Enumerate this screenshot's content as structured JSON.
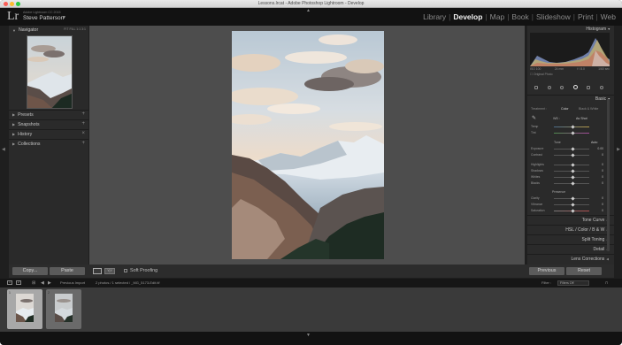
{
  "window": {
    "title": "Lessons.lrcat - Adobe Photoshop Lightroom - Develop"
  },
  "identity": {
    "logo": "Lr",
    "catalog_line": "Adobe Lightroom CC 2015",
    "user_name": "Steve Patterson"
  },
  "modules": [
    "Library",
    "Develop",
    "Map",
    "Book",
    "Slideshow",
    "Print",
    "Web"
  ],
  "active_module": "Develop",
  "left_panel": {
    "navigator": {
      "title": "Navigator",
      "zoom_options": "FIT  FILL  1:1  3:1"
    },
    "sections": [
      "Presets",
      "Snapshots",
      "History",
      "Collections"
    ],
    "copy_label": "Copy...",
    "paste_label": "Paste"
  },
  "toolbar": {
    "soft_proofing": "Soft Proofing",
    "compare_icon_label": "Y|Y"
  },
  "right_panel": {
    "histogram_title": "Histogram",
    "hist_info": [
      "ISO 100",
      "24 mm",
      "f / 8.0",
      "1/60 sec"
    ],
    "original_photo": "Original Photo",
    "basic_title": "Basic",
    "treatment_label": "Treatment :",
    "color_label": "Color",
    "bw_label": "Black & White",
    "wb_label": "WB :",
    "wb_value": "As Shot",
    "temp_label": "Temp",
    "tint_label": "Tint",
    "tone_label": "Tone",
    "auto_label": "Auto",
    "exposure": {
      "label": "Exposure",
      "value": "0.00"
    },
    "contrast": {
      "label": "Contrast",
      "value": "0"
    },
    "highlights": {
      "label": "Highlights",
      "value": "0"
    },
    "shadows": {
      "label": "Shadows",
      "value": "0"
    },
    "whites": {
      "label": "Whites",
      "value": "0"
    },
    "blacks": {
      "label": "Blacks",
      "value": "0"
    },
    "presence_label": "Presence",
    "clarity": {
      "label": "Clarity",
      "value": "0"
    },
    "vibrance": {
      "label": "Vibrance",
      "value": "0"
    },
    "saturation": {
      "label": "Saturation",
      "value": "0"
    },
    "sections": [
      "Tone Curve",
      "HSL  /  Color  /  B & W",
      "Split Toning",
      "Detail",
      "Lens Corrections"
    ],
    "previous_label": "Previous",
    "reset_label": "Reset"
  },
  "filmstrip": {
    "screen_nums": [
      "1",
      "2"
    ],
    "source": "Previous Import",
    "info": "2 photos / 1 selected / _MG_5173-Edit.tif",
    "filter_label": "Filter :",
    "filter_value": "Filters Off",
    "thumb_numbers": [
      "1",
      "2"
    ]
  }
}
